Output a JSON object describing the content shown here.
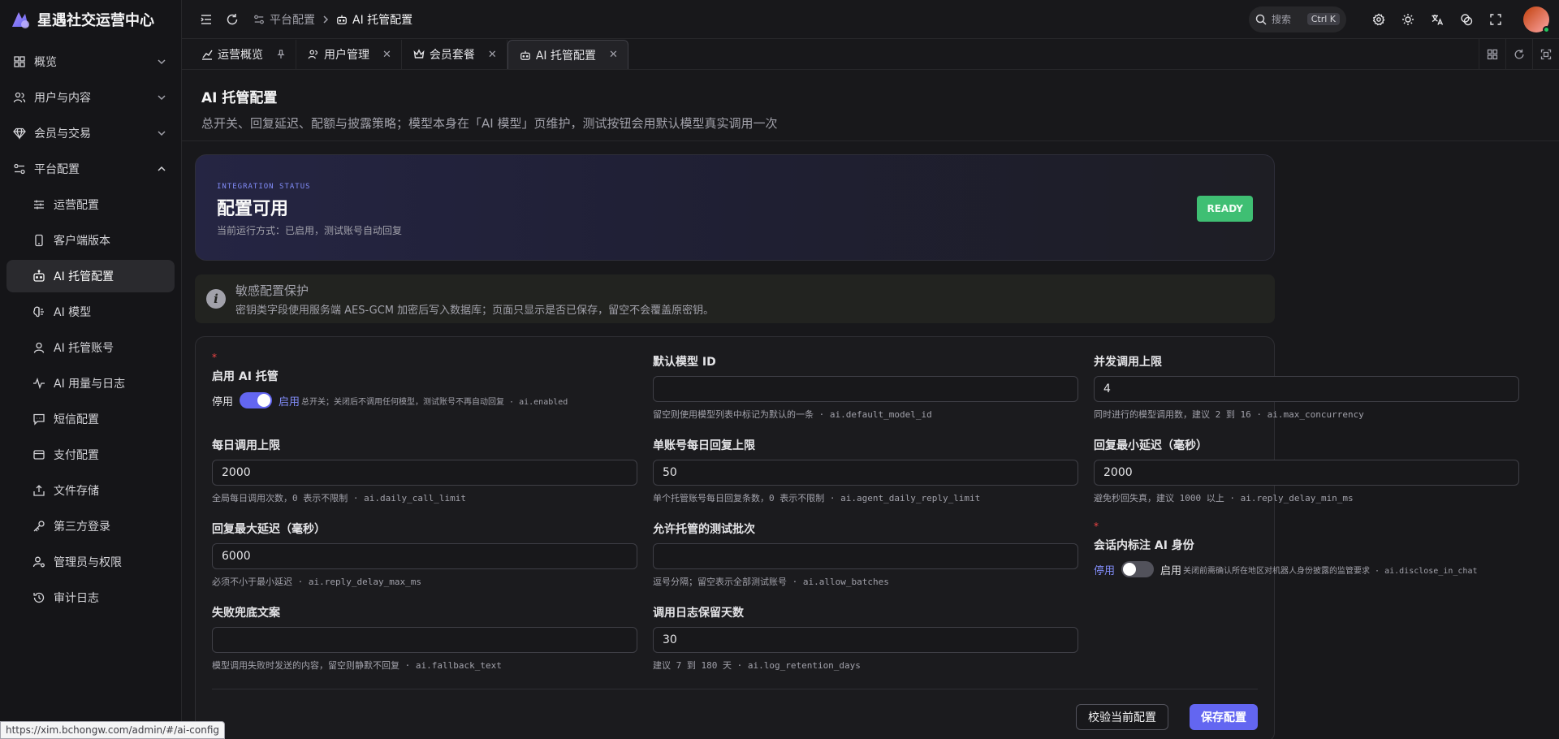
{
  "app": {
    "name": "星遇社交运营中心"
  },
  "sidebar": {
    "items": [
      {
        "label": "概览",
        "icon": "grid-icon"
      },
      {
        "label": "用户与内容",
        "icon": "users-icon"
      },
      {
        "label": "会员与交易",
        "icon": "diamond-icon"
      },
      {
        "label": "平台配置",
        "icon": "settings-sliders-icon"
      }
    ],
    "sub": [
      {
        "label": "运营配置"
      },
      {
        "label": "客户端版本"
      },
      {
        "label": "AI 托管配置"
      },
      {
        "label": "AI 模型"
      },
      {
        "label": "AI 托管账号"
      },
      {
        "label": "AI 用量与日志"
      },
      {
        "label": "短信配置"
      },
      {
        "label": "支付配置"
      },
      {
        "label": "文件存储"
      },
      {
        "label": "第三方登录"
      },
      {
        "label": "管理员与权限"
      },
      {
        "label": "审计日志"
      }
    ]
  },
  "header": {
    "crumbs": [
      "平台配置",
      "AI 托管配置"
    ],
    "search_label": "搜索",
    "search_kbd": "Ctrl K"
  },
  "tabs": [
    {
      "label": "运营概览"
    },
    {
      "label": "用户管理"
    },
    {
      "label": "会员套餐"
    },
    {
      "label": "AI 托管配置"
    }
  ],
  "page": {
    "title": "AI 托管配置",
    "desc": "总开关、回复延迟、配额与披露策略；模型本身在「AI 模型」页维护，测试按钮会用默认模型真实调用一次"
  },
  "status": {
    "kicker": "INTEGRATION STATUS",
    "title": "配置可用",
    "sub": "当前运行方式：已启用，测试账号自动回复",
    "badge": "READY"
  },
  "notice": {
    "title": "敏感配置保护",
    "text": "密钥类字段使用服务端 AES-GCM 加密后写入数据库；页面只显示是否已保存，留空不会覆盖原密钥。"
  },
  "form": {
    "req_mark": "*",
    "enabled": {
      "label": "启用 AI 托管",
      "off": "停用",
      "on": "启用",
      "hint": "总开关；关闭后不调用任何模型，测试账号不再自动回复 · ai.enabled"
    },
    "default_model": {
      "label": "默认模型 ID",
      "value": "",
      "hint": "留空则使用模型列表中标记为默认的一条 · ai.default_model_id"
    },
    "concurrency": {
      "label": "并发调用上限",
      "value": "4",
      "hint": "同时进行的模型调用数，建议 2 到 16 · ai.max_concurrency"
    },
    "daily_limit": {
      "label": "每日调用上限",
      "value": "2000",
      "hint": "全局每日调用次数，0 表示不限制 · ai.daily_call_limit"
    },
    "agent_limit": {
      "label": "单账号每日回复上限",
      "value": "50",
      "hint": "单个托管账号每日回复条数，0 表示不限制 · ai.agent_daily_reply_limit"
    },
    "delay_min": {
      "label": "回复最小延迟（毫秒）",
      "value": "2000",
      "hint": "避免秒回失真，建议 1000 以上 · ai.reply_delay_min_ms"
    },
    "delay_max": {
      "label": "回复最大延迟（毫秒）",
      "value": "6000",
      "hint": "必须不小于最小延迟 · ai.reply_delay_max_ms"
    },
    "batches": {
      "label": "允许托管的测试批次",
      "value": "",
      "hint": "逗号分隔；留空表示全部测试账号 · ai.allow_batches"
    },
    "disclose": {
      "label": "会话内标注 AI 身份",
      "off": "停用",
      "on": "启用",
      "hint": "关闭前需确认所在地区对机器人身份披露的监管要求 · ai.disclose_in_chat"
    },
    "fallback": {
      "label": "失败兜底文案",
      "value": "",
      "hint": "模型调用失败时发送的内容，留空则静默不回复 · ai.fallback_text"
    },
    "retention": {
      "label": "调用日志保留天数",
      "value": "30",
      "hint": "建议 7 到 180 天 · ai.log_retention_days"
    },
    "validate_btn": "校验当前配置",
    "save_btn": "保存配置"
  },
  "statusbar": {
    "url": "https://xim.bchongw.com/admin/#/ai-config"
  },
  "colors": {
    "accent": "#6366f1",
    "ready": "#3fbf73",
    "required": "#ef4444"
  }
}
